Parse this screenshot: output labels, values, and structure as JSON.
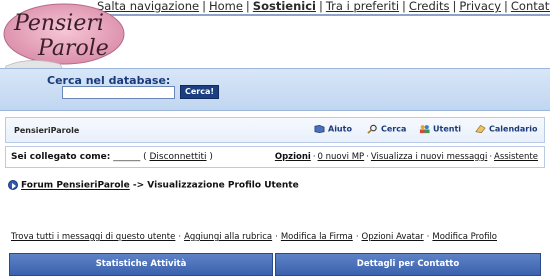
{
  "header": {
    "logo_line1": "Pensieri",
    "logo_line2": "Parole",
    "top_links": [
      {
        "label": "Salta navigazione",
        "bold": false
      },
      {
        "label": "Home",
        "bold": false
      },
      {
        "label": "Sostienici",
        "bold": true
      },
      {
        "label": "Tra i preferiti",
        "bold": false
      },
      {
        "label": "Credits",
        "bold": false
      },
      {
        "label": "Privacy",
        "bold": false
      },
      {
        "label": "Contattaci",
        "bold": false
      }
    ],
    "separator": "|"
  },
  "search": {
    "label": "Cerca nel database:",
    "value": "",
    "button_label": "Cerca!"
  },
  "navbar": {
    "site_name": "PensieriParole",
    "links": [
      {
        "label": "Aiuto",
        "icon": "help-icon"
      },
      {
        "label": "Cerca",
        "icon": "magnifier-icon"
      },
      {
        "label": "Utenti",
        "icon": "users-icon"
      },
      {
        "label": "Calendario",
        "icon": "calendar-icon"
      }
    ]
  },
  "userbar": {
    "logged_prefix": "Sei collegato come:",
    "username": "______",
    "logout_label": "Disconnettiti",
    "links": [
      {
        "label": "Opzioni",
        "bold": true
      },
      {
        "label": "0 nuovi MP",
        "bold": false
      },
      {
        "label": "Visualizza i nuovi messaggi",
        "bold": false
      },
      {
        "label": "Assistente",
        "bold": false
      }
    ]
  },
  "breadcrumb": {
    "forum_link": "Forum PensieriParole",
    "current": "-> Visualizzazione Profilo Utente"
  },
  "profile_links": [
    "Trova tutti i messaggi di questo utente",
    "Aggiungi alla rubrica",
    "Modifica la Firma",
    "Opzioni Avatar",
    "Modifica Profilo"
  ],
  "sections": {
    "left": "Statistiche Attività",
    "right": "Dettagli per Contatto"
  },
  "colors": {
    "accent": "#1c3f82",
    "band": "#c9dcf3",
    "section_header": "#4a6fbb"
  }
}
